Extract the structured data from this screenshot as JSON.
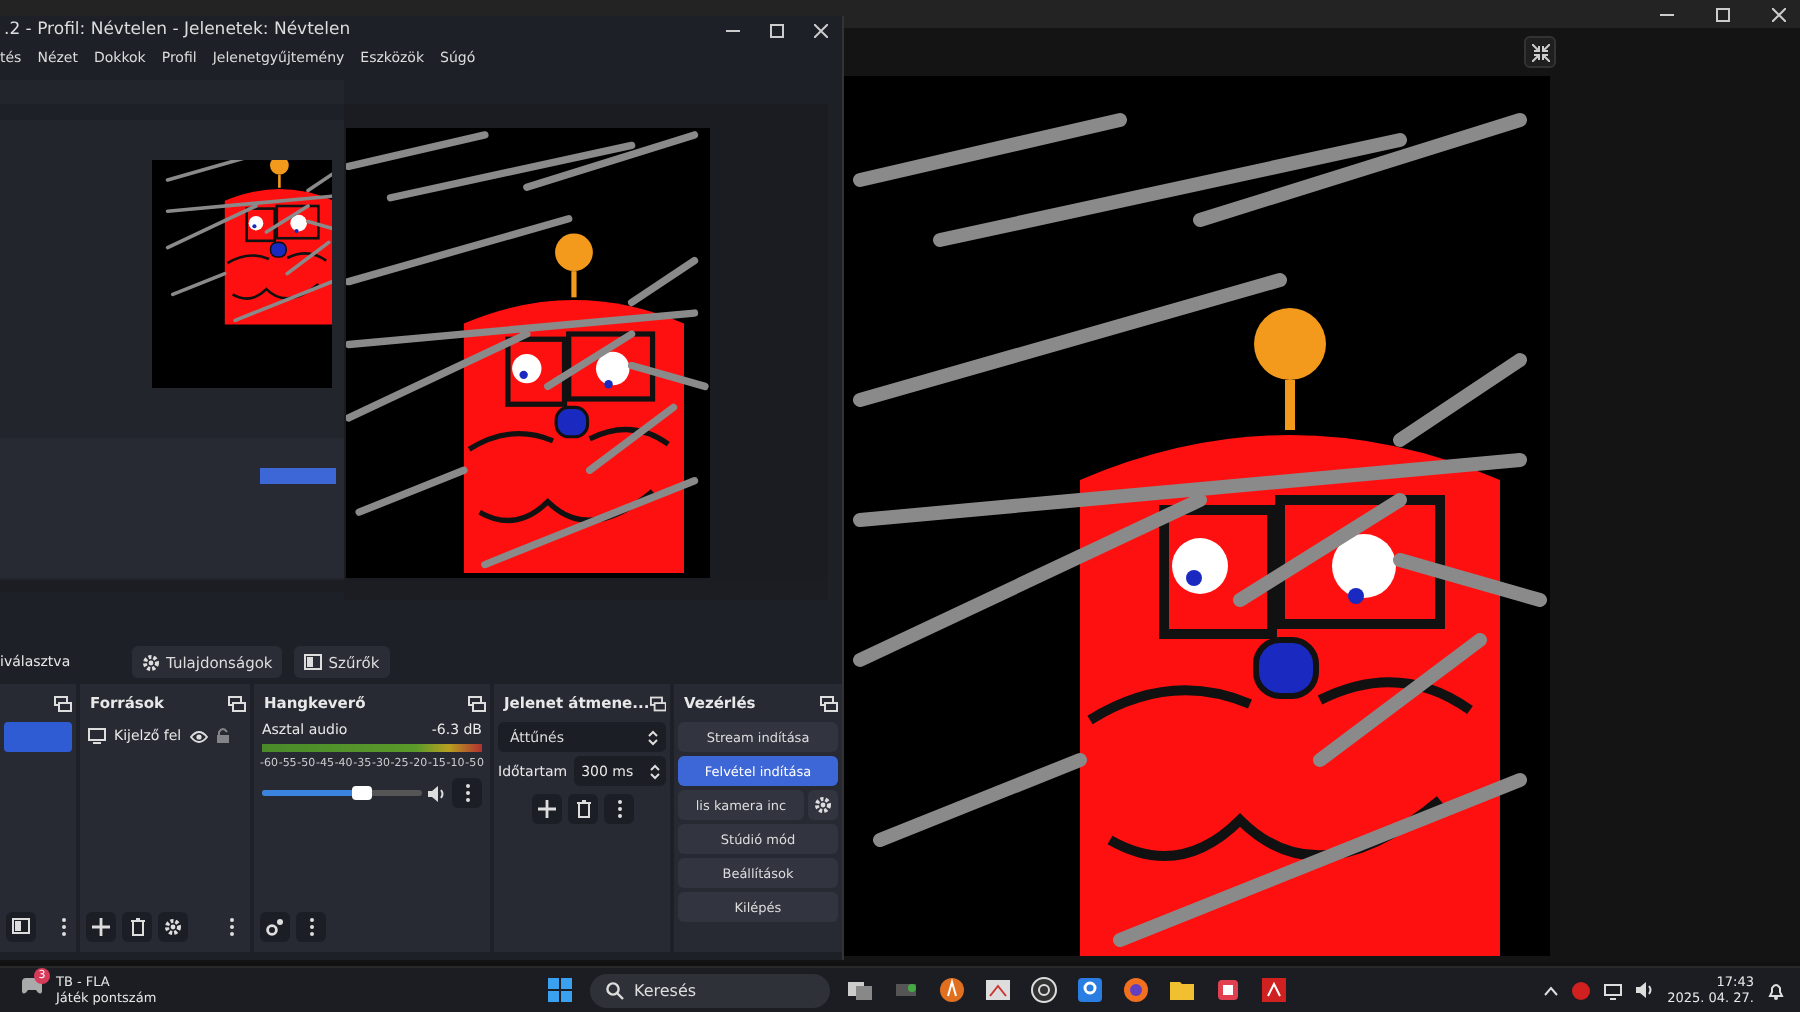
{
  "obs_window": {
    "title": ".2 - Profil: Névtelen - Jelenetek: Névtelen",
    "menu": [
      {
        "label": "tés"
      },
      {
        "label": "Nézet"
      },
      {
        "label": "Dokkok"
      },
      {
        "label": "Profil"
      },
      {
        "label": "Jelenetgyűjtemény"
      },
      {
        "label": "Eszközök"
      },
      {
        "label": "Súgó"
      }
    ],
    "context_bar": {
      "label": "iválasztva",
      "buttons": [
        {
          "label": "Tulajdonságok",
          "kind": "gear"
        },
        {
          "label": "Szűrők",
          "kind": "filter"
        }
      ]
    },
    "scenes": {
      "items": [
        {
          "selected": true
        }
      ]
    },
    "sources": {
      "title": "Források",
      "items": [
        {
          "label": "Kijelző fel",
          "visible": true,
          "locked": false
        }
      ]
    },
    "mixer": {
      "title": "Hangkeverő",
      "channels": [
        {
          "name": "Asztal audio",
          "reading": "-6.3 dB",
          "level": 0.62,
          "muted": false
        }
      ],
      "scale": [
        "-60",
        "-55",
        "-50",
        "-45",
        "-40",
        "-35",
        "-30",
        "-25",
        "-20",
        "-15",
        "-10",
        "-5",
        "0"
      ]
    },
    "transitions": {
      "title": "Jelenet átmene...",
      "transition": "Áttűnés",
      "duration_label": "Időtartam",
      "duration": "300 ms"
    },
    "controls": {
      "title": "Vezérlés",
      "buttons": [
        {
          "label": "Stream indítása",
          "kind": "plain",
          "highlighted": false
        },
        {
          "label": "Felvétel indítása",
          "kind": "plain",
          "highlighted": true
        },
        {
          "label": "lis kamera inc",
          "kind": "with_settings",
          "highlighted": false
        },
        {
          "label": "Stúdió mód",
          "kind": "plain",
          "highlighted": false
        },
        {
          "label": "Beállítások",
          "kind": "plain",
          "highlighted": false
        },
        {
          "label": "Kilépés",
          "kind": "plain",
          "highlighted": false
        }
      ]
    }
  },
  "taskbar": {
    "widget": {
      "title": "TB - FLA",
      "subtitle": "Játék pontszám",
      "badge": "3"
    },
    "search": {
      "placeholder": "Keresés"
    },
    "clock": {
      "time": "17:43",
      "date": "2025. 04. 27."
    }
  }
}
